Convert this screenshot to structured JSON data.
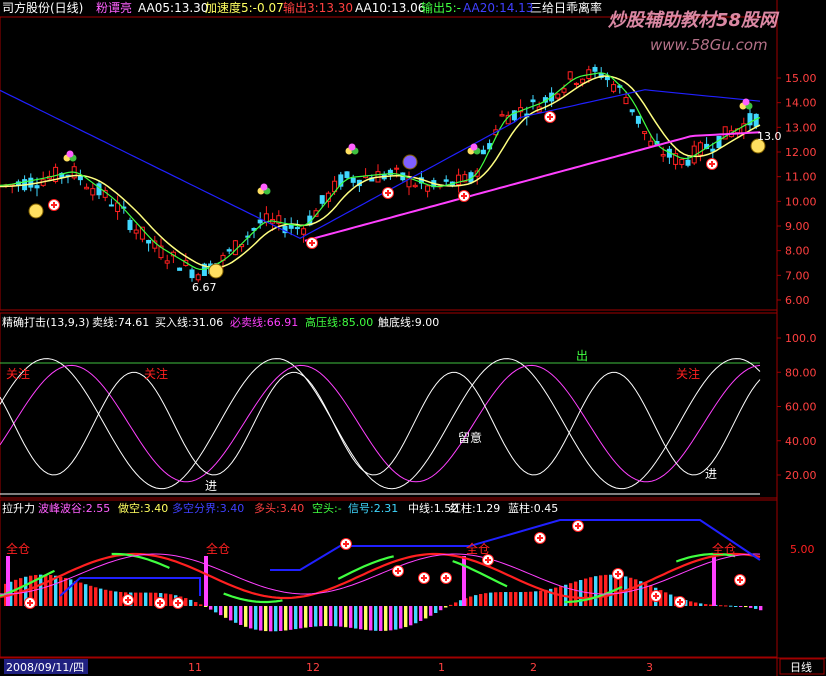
{
  "header": {
    "title": "司方股份(日线)",
    "name": "粉谭亮",
    "ma5": "AA05:13.30",
    "accel": "加速度5:-0.07",
    "out1": "输出3:13.30",
    "ma10": "AA10:13.06",
    "out2": "输出5:-",
    "blue": "AA20:14.13",
    "deviate": "三给日乖离率",
    "watermark": "炒股辅助教材58股网",
    "url": "www.58Gu.com"
  },
  "panel1": {
    "y_ticks": [
      "15.00",
      "14.00",
      "13.00",
      "12.00",
      "11.00",
      "10.00",
      "9.00",
      "8.00",
      "7.00",
      "6.00"
    ],
    "low_label": "6.67",
    "last_label": "13.0"
  },
  "panel2": {
    "title": "精确打击(13,9,3)",
    "sell": "卖线:74.61",
    "buy": "买入线:31.06",
    "must_sell": "必卖线:66.91",
    "high": "高压线:85.00",
    "bottom": "触底线:9.00",
    "y_ticks": [
      "100.0",
      "80.00",
      "60.00",
      "40.00",
      "20.00"
    ],
    "labels": [
      "关注",
      "关注",
      "留意",
      "出",
      "关注",
      "进",
      "进"
    ]
  },
  "panel3": {
    "title": "拉升力",
    "wave": "波峰波谷:2.55",
    "short": "做空:3.40",
    "bull_bear": "多空分界:3.40",
    "long": "多头:3.40",
    "empty": "空头:-",
    "signal": "信号:2.31",
    "mid": "中线:1.52",
    "red": "红柱:1.29",
    "blue": "蓝柱:0.45",
    "y_tick": "5.00",
    "labels": [
      "全仓",
      "全仓",
      "全仓",
      "全仓"
    ]
  },
  "xaxis": {
    "date": "2008/09/11/四",
    "ticks": [
      "11",
      "12",
      "1",
      "2",
      "3"
    ],
    "period": "日线"
  },
  "colors": {
    "up": "#ff2020",
    "down": "#40d8ff",
    "ma_yellow": "#ffff80",
    "ma_magenta": "#ff40ff",
    "ma_blue": "#2020ff",
    "ma_green": "#40ff40",
    "frame": "#a00000"
  }
}
